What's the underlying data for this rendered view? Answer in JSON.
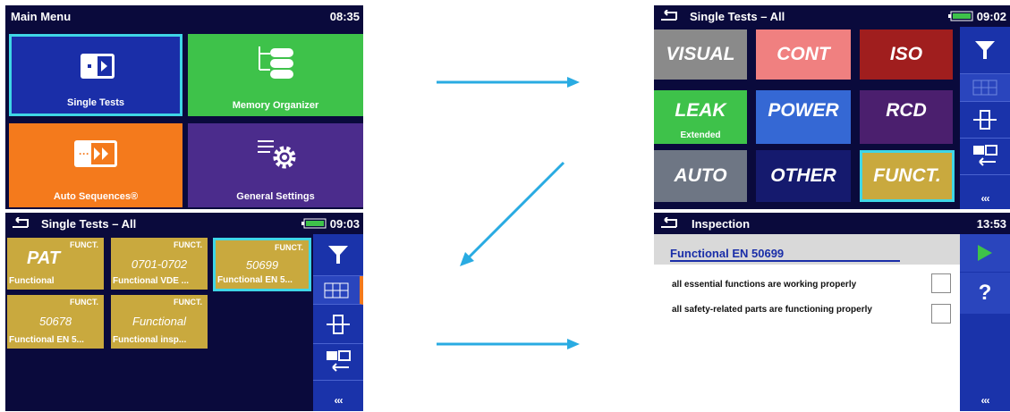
{
  "main_menu": {
    "title": "Main Menu",
    "time": "08:35",
    "tiles": [
      {
        "label": "Single Tests",
        "color": "#1a2ea8"
      },
      {
        "label": "Memory Organizer",
        "color": "#3ec24a"
      },
      {
        "label": "Auto Sequences®",
        "color": "#f47a1c"
      },
      {
        "label": "General Settings",
        "color": "#4b2c8c"
      }
    ]
  },
  "single_tests_groups": {
    "title": "Single Tests – All",
    "time": "09:02",
    "groups": [
      {
        "label": "VISUAL",
        "sub": "",
        "color": "#8a8a8a"
      },
      {
        "label": "CONT",
        "sub": "",
        "color": "#f08080"
      },
      {
        "label": "ISO",
        "sub": "",
        "color": "#a01e1e"
      },
      {
        "label": "LEAK",
        "sub": "Extended",
        "color": "#3ec24a"
      },
      {
        "label": "POWER",
        "sub": "",
        "color": "#3568d4"
      },
      {
        "label": "RCD",
        "sub": "",
        "color": "#4b1f6e"
      },
      {
        "label": "AUTO",
        "sub": "",
        "color": "#6e7684"
      },
      {
        "label": "OTHER",
        "sub": "",
        "color": "#151a6e"
      },
      {
        "label": "FUNCT.",
        "sub": "",
        "color": "#c9a93e"
      }
    ],
    "more": "‹‹‹"
  },
  "single_tests_funct": {
    "title": "Single Tests – All",
    "time": "09:03",
    "tests": [
      {
        "cat": "FUNCT.",
        "big": "PAT",
        "name": "Functional"
      },
      {
        "cat": "FUNCT.",
        "big": "0701-0702",
        "name": "Functional VDE ..."
      },
      {
        "cat": "FUNCT.",
        "big": "50699",
        "name": "Functional EN 5..."
      },
      {
        "cat": "FUNCT.",
        "big": "50678",
        "name": "Functional EN 5..."
      },
      {
        "cat": "FUNCT.",
        "big": "Functional",
        "name": "Functional insp..."
      }
    ],
    "more": "‹‹‹"
  },
  "inspection": {
    "title": "Inspection",
    "time": "13:53",
    "heading": "Functional EN 50699",
    "items": [
      {
        "text": "all essential functions are working properly"
      },
      {
        "text": "all safety-related parts are functioning properly"
      }
    ],
    "help": "?",
    "more": "‹‹‹"
  },
  "colors": {
    "accent": "#29abe2",
    "screen_bg": "#0a0a3c",
    "sidebar": "#1a33aa",
    "selection": "#3fd6e6"
  }
}
